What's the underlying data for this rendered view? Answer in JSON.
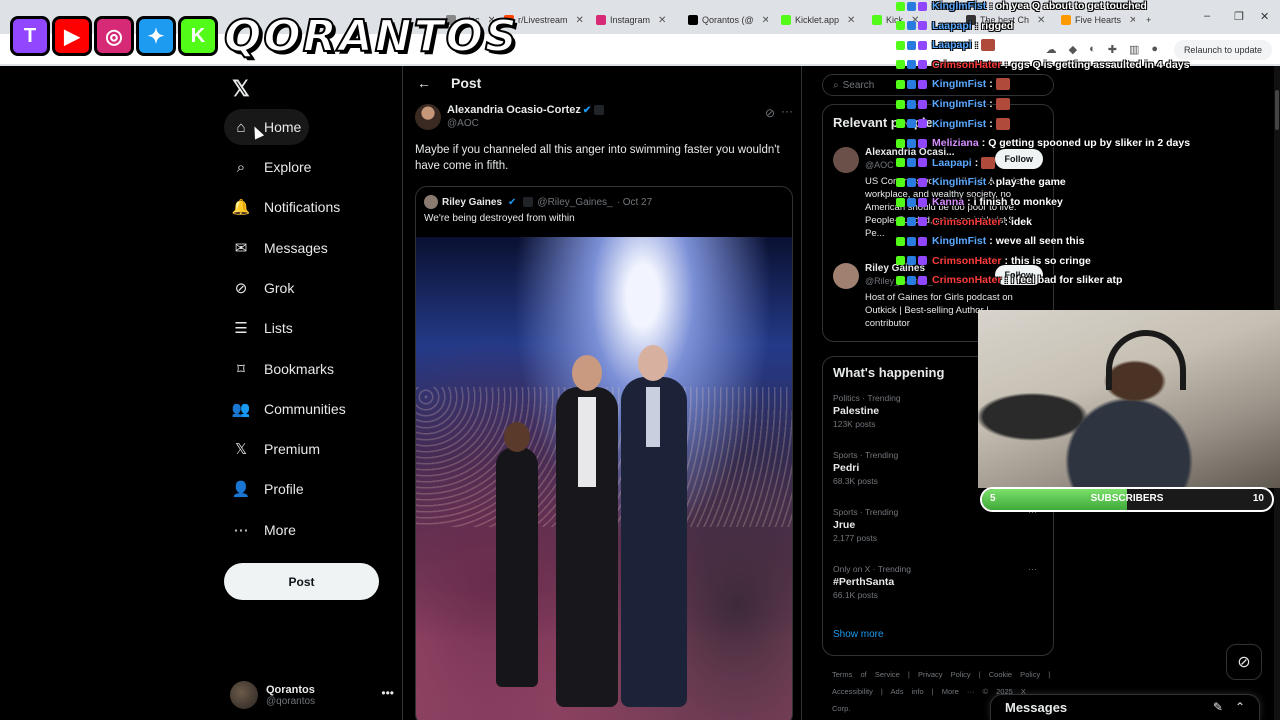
{
  "browser": {
    "tabs": [
      {
        "label": "m/pc",
        "color": "#888888"
      },
      {
        "label": "r/Livestream",
        "color": "#ff4500"
      },
      {
        "label": "Instagram",
        "color": "#d62976"
      },
      {
        "label": "Qorantos (@",
        "color": "#000000"
      },
      {
        "label": "Kicklet.app",
        "color": "#53fc18"
      },
      {
        "label": "Kick",
        "color": "#53fc18"
      },
      {
        "label": "The best Ch",
        "color": "#333333"
      },
      {
        "label": "Five Hearts",
        "color": "#ff9900"
      }
    ],
    "relaunch_label": "Relaunch to update"
  },
  "overlay": {
    "brand": "QORANTOS",
    "socials": [
      {
        "name": "twitch-icon",
        "glyph": "T",
        "color": "#9146ff"
      },
      {
        "name": "youtube-icon",
        "glyph": "▶",
        "color": "#ff0000"
      },
      {
        "name": "instagram-icon",
        "glyph": "◎",
        "color": "#d62976"
      },
      {
        "name": "twitter-bird-icon",
        "glyph": "✦",
        "color": "#1d9bf0"
      },
      {
        "name": "kick-icon",
        "glyph": "K",
        "color": "#53fc18"
      }
    ]
  },
  "sidebar": {
    "items": [
      {
        "label": "Home",
        "icon": "home-icon",
        "glyph": "⌂"
      },
      {
        "label": "Explore",
        "icon": "search-icon",
        "glyph": "⌕"
      },
      {
        "label": "Notifications",
        "icon": "bell-icon",
        "glyph": "🔔"
      },
      {
        "label": "Messages",
        "icon": "mail-icon",
        "glyph": "✉"
      },
      {
        "label": "Grok",
        "icon": "grok-icon",
        "glyph": "⊘"
      },
      {
        "label": "Lists",
        "icon": "list-icon",
        "glyph": "☰"
      },
      {
        "label": "Bookmarks",
        "icon": "bookmark-icon",
        "glyph": "⌑"
      },
      {
        "label": "Communities",
        "icon": "people-icon",
        "glyph": "👥"
      },
      {
        "label": "Premium",
        "icon": "x-premium-icon",
        "glyph": "𝕏"
      },
      {
        "label": "Profile",
        "icon": "person-icon",
        "glyph": "👤"
      },
      {
        "label": "More",
        "icon": "more-circle-icon",
        "glyph": "⋯"
      }
    ],
    "post_label": "Post",
    "account": {
      "name": "Qorantos",
      "handle": "@qorantos"
    }
  },
  "main": {
    "header_title": "Post",
    "author": {
      "name": "Alexandria Ocasio-Cortez",
      "handle": "@AOC"
    },
    "text": "Maybe if you channeled all this anger into swimming faster you wouldn't have come in fifth.",
    "quote": {
      "name": "Riley Gaines",
      "handle": "@Riley_Gaines_",
      "date": "· Oct 27",
      "text": "We're being destroyed from within"
    }
  },
  "right": {
    "search_placeholder": "Search",
    "relevant_title": "Relevant people",
    "people": [
      {
        "name": "Alexandria Ocasi...",
        "handle": "@AOC",
        "bio": "US Congresswoman, NY-14. A modern workplace, and wealthy society, no American should be too poor to live. People-Funded, takes no lobbyist $. Pe...",
        "follow": "Follow"
      },
      {
        "name": "Riley Gaines",
        "handle": "@Riley_Gaines_",
        "bio": "Host of Gaines for Girls podcast on Outkick | Best-selling Author | contributor",
        "follow": "Follow"
      }
    ],
    "happening_title": "What's happening",
    "trends": [
      {
        "category": "Politics · Trending",
        "name": "Palestine",
        "posts": "123K posts"
      },
      {
        "category": "Sports · Trending",
        "name": "Pedri",
        "posts": "68.3K posts"
      },
      {
        "category": "Sports · Trending",
        "name": "Jrue",
        "posts": "2,177 posts"
      },
      {
        "category": "Only on X · Trending",
        "name": "#PerthSanta",
        "posts": "66.1K posts"
      }
    ],
    "show_more": "Show more",
    "footer": "Terms of Service | Privacy Policy | Cookie Policy | Accessibility | Ads info | More ··· © 2025 X Corp."
  },
  "chat": [
    {
      "user": "KingImFist",
      "color": "#5aa9ff",
      "msg": "oh yea Q about to get touched"
    },
    {
      "user": "Laapapi",
      "color": "#5aa9ff",
      "msg": "rigged"
    },
    {
      "user": "Laapapi",
      "color": "#5aa9ff",
      "msg": ""
    },
    {
      "user": "CrimsonHater",
      "color": "#ff3b3b",
      "msg": "ggs Q is getting assaulted in 4 days"
    },
    {
      "user": "KingImFist",
      "color": "#5aa9ff",
      "msg": ""
    },
    {
      "user": "KingImFist",
      "color": "#5aa9ff",
      "msg": ""
    },
    {
      "user": "KingImFist",
      "color": "#5aa9ff",
      "msg": ""
    },
    {
      "user": "Meliziana",
      "color": "#d58cff",
      "msg": "Q getting spooned up by sliker in 2 days"
    },
    {
      "user": "Laapapi",
      "color": "#5aa9ff",
      "msg": ""
    },
    {
      "user": "KingImFist",
      "color": "#5aa9ff",
      "msg": "play the game"
    },
    {
      "user": "Kanna",
      "color": "#d58cff",
      "msg": "i finish to monkey"
    },
    {
      "user": "CrimsonHater",
      "color": "#ff3b3b",
      "msg": "idek"
    },
    {
      "user": "KingImFist",
      "color": "#5aa9ff",
      "msg": "weve all seen this"
    },
    {
      "user": "CrimsonHater",
      "color": "#ff3b3b",
      "msg": "this is so cringe"
    },
    {
      "user": "CrimsonHater",
      "color": "#ff3b3b",
      "msg": "i feel bad for sliker atp"
    }
  ],
  "subscribers": {
    "start": "5",
    "label": "SUBSCRIBERS",
    "goal": "10",
    "progress": 0.5
  },
  "messages_drawer": {
    "title": "Messages"
  }
}
